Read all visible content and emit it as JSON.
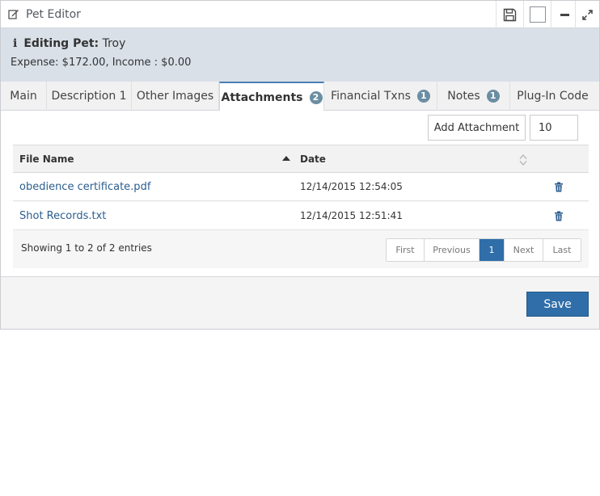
{
  "window": {
    "title": "Pet Editor"
  },
  "info": {
    "label": "Editing Pet:",
    "pet_name": "Troy",
    "summary": "Expense: $172.00, Income : $0.00"
  },
  "tabs": [
    {
      "label": "Main",
      "badge": null
    },
    {
      "label": "Description 1",
      "badge": null
    },
    {
      "label": "Other Images",
      "badge": null
    },
    {
      "label": "Attachments",
      "badge": "2",
      "active": true
    },
    {
      "label": "Financial Txns",
      "badge": "1"
    },
    {
      "label": "Notes",
      "badge": "1"
    },
    {
      "label": "Plug-In Code",
      "badge": null
    }
  ],
  "toolbar": {
    "add_label": "Add Attachment",
    "page_size": "10"
  },
  "table": {
    "columns": [
      "File Name",
      "Date"
    ],
    "rows": [
      {
        "file": "obedience certificate.pdf",
        "date": "12/14/2015 12:54:05"
      },
      {
        "file": "Shot Records.txt",
        "date": "12/14/2015 12:51:41"
      }
    ],
    "entries": "Showing 1 to 2 of 2 entries"
  },
  "pager": {
    "first": "First",
    "previous": "Previous",
    "current": "1",
    "next": "Next",
    "last": "Last"
  },
  "footer": {
    "save_label": "Save"
  },
  "colors": {
    "accent": "#2f6ea8",
    "infobar": "#d9e0e8",
    "badge": "#6b8ea3",
    "link": "#2c5d8f"
  },
  "icons": [
    "edit-icon",
    "save-icon",
    "minimize-icon",
    "expand-icon",
    "info-icon",
    "sort-asc-icon",
    "sort-both-icon",
    "trash-icon"
  ]
}
